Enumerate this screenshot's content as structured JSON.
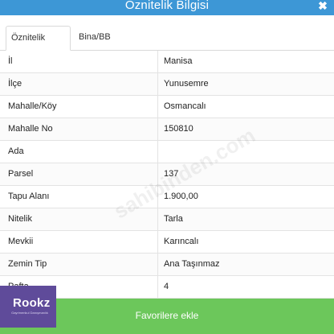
{
  "window": {
    "title": "Öznitelik Bilgisi",
    "close_icon": "✖"
  },
  "tabs": [
    {
      "label": "Öznitelik Bilgisi",
      "active": true
    },
    {
      "label": "Bina/BB Listesi",
      "active": false
    }
  ],
  "rows": [
    {
      "label": "İl",
      "value": "Manisa"
    },
    {
      "label": "İlçe",
      "value": "Yunusemre"
    },
    {
      "label": "Mahalle/Köy",
      "value": "Osmancalı"
    },
    {
      "label": "Mahalle No",
      "value": "150810"
    },
    {
      "label": "Ada",
      "value": ""
    },
    {
      "label": "Parsel",
      "value": "137"
    },
    {
      "label": "Tapu Alanı",
      "value": "1.900,00"
    },
    {
      "label": "Nitelik",
      "value": "Tarla"
    },
    {
      "label": "Mevkii",
      "value": "Karıncalı"
    },
    {
      "label": "Zemin Tip",
      "value": "Ana Taşınmaz"
    },
    {
      "label": "Pafta",
      "value": "4"
    }
  ],
  "footer": {
    "favorite_label": "Favorilere ekle"
  },
  "overlay": {
    "watermark": "sahibinden.com",
    "logo_brand": "Rookz",
    "logo_tagline": "Gayrimenkul Danışmanlık",
    "logo_color": "#5f4b9a"
  }
}
